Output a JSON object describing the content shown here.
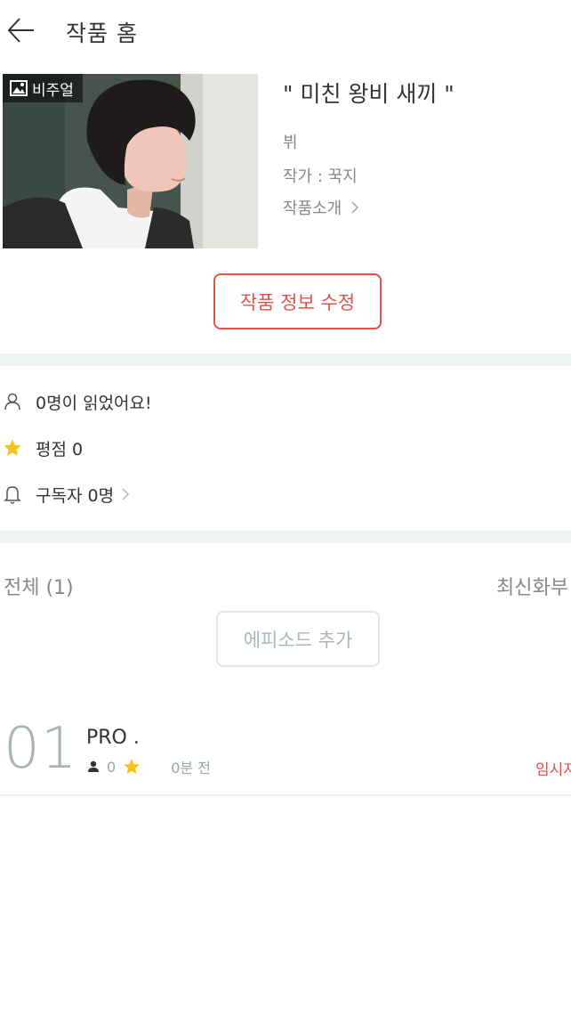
{
  "header": {
    "title": "작품 홈",
    "back_icon": "arrow-left-icon"
  },
  "work": {
    "visual_badge": "비주얼",
    "title": "\" 미친 왕비 새끼 \"",
    "genre": "뷔",
    "author": "작가 : 꾹지",
    "intro_label": "작품소개",
    "edit_button": "작품 정보 수정"
  },
  "stats": {
    "readers": "0명이 읽었어요!",
    "rating": "평점 0",
    "subscribers": "구독자 0명"
  },
  "episodes": {
    "total_label": "전체 (1)",
    "sort_label": "최신화부",
    "add_button": "에피소드 추가",
    "items": [
      {
        "number": "01",
        "title": "PRO .",
        "views": "0",
        "time": "0분 전",
        "status": "임시저"
      }
    ]
  },
  "colors": {
    "accent": "#e0534b",
    "star": "#f6c21c",
    "muted": "#888888",
    "divider": "#eef3f3"
  }
}
